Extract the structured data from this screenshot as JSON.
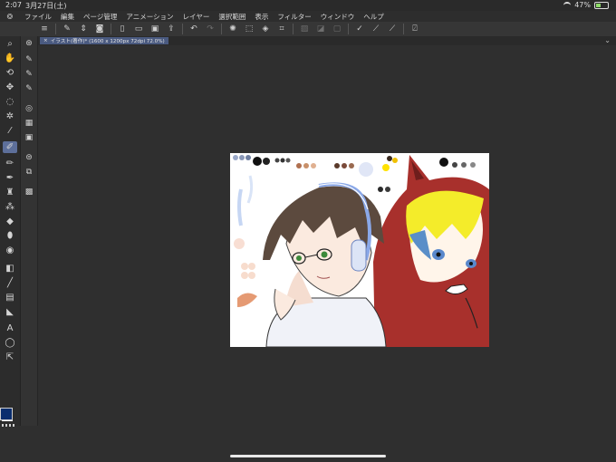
{
  "status": {
    "time": "2:07",
    "date": "3月27日(土)",
    "battery": "47%"
  },
  "menu": {
    "items": [
      "ファイル",
      "編集",
      "ページ管理",
      "アニメーション",
      "レイヤー",
      "選択範囲",
      "表示",
      "フィルター",
      "ウィンドウ",
      "ヘルプ"
    ]
  },
  "document": {
    "tab_label": "イラスト(著作)* (1600 x 1200px 72dpi 72.0%)"
  },
  "colors": {
    "main": "#0b2e6e",
    "sub": "#ffffff",
    "accent": "#5d6f9a"
  },
  "icons": {
    "command_bar": [
      "menu-icon",
      "new-icon",
      "stepper-icon",
      "camera-icon",
      "new-page-icon",
      "open-icon",
      "save-icon",
      "upload-icon",
      "undo-icon",
      "redo-icon",
      "spinner-icon",
      "transform-icon",
      "fill-icon",
      "crop-icon",
      "select-off-icon",
      "select-invert-icon",
      "select-all-icon",
      "pen-icon",
      "ruler-icon",
      "brush-icon",
      "edit-icon"
    ],
    "tools": [
      "zoom-icon",
      "hand-icon",
      "rotate-icon",
      "move-icon",
      "lasso-icon",
      "wand-icon",
      "eyedropper-icon",
      "pen-icon",
      "pencil-icon",
      "brush-icon",
      "airbrush-icon",
      "decoration-icon",
      "eraser-icon",
      "blend-icon",
      "fill-icon",
      "gradient-icon",
      "line-icon",
      "frame-icon",
      "ruler-icon",
      "text-icon",
      "balloon-icon",
      "correct-line-icon"
    ]
  }
}
